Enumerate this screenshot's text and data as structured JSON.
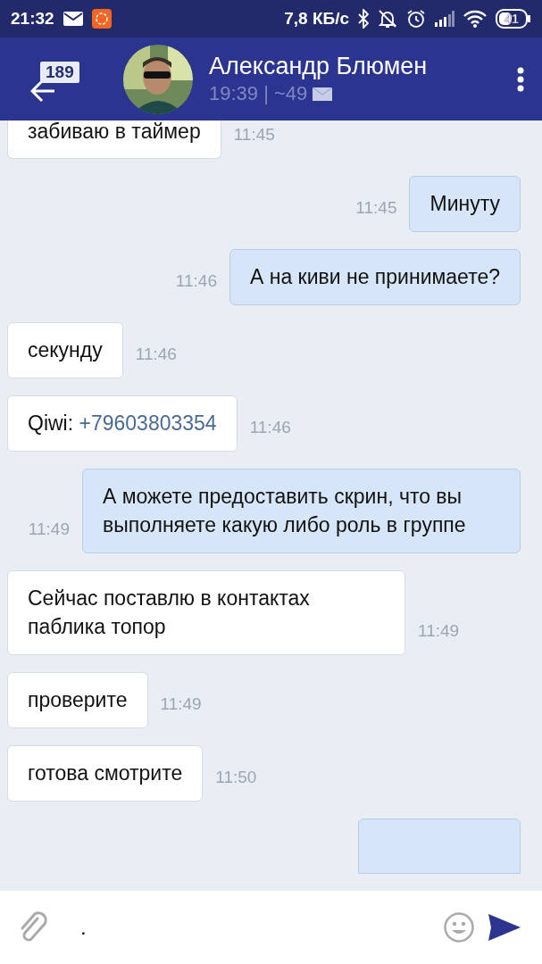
{
  "status_bar": {
    "time": "21:32",
    "speed": "7,8 КБ/с",
    "battery": "41"
  },
  "header": {
    "unread_badge": "189",
    "name": "Александр Блюмен",
    "last_seen": "19:39 | ~49"
  },
  "messages": [
    {
      "kind": "incoming",
      "text": "забиваю в таймер",
      "time": "11:45",
      "cut_top": true
    },
    {
      "kind": "outgoing",
      "text": "Минуту",
      "time": "11:45"
    },
    {
      "kind": "outgoing",
      "text": "А на киви не принимаете?",
      "time": "11:46"
    },
    {
      "kind": "incoming",
      "text": "секунду",
      "time": "11:46"
    },
    {
      "kind": "incoming",
      "text": "Qiwi: ",
      "link": "+79603803354",
      "time": "11:46"
    },
    {
      "kind": "outgoing",
      "text": "А можете предоставить скрин, что вы выполняете какую либо роль в группе",
      "time": "11:49"
    },
    {
      "kind": "incoming",
      "text": "Сейчас поставлю в контактах паблика топор",
      "time": "11:49"
    },
    {
      "kind": "incoming",
      "text": "проверите",
      "time": "11:49"
    },
    {
      "kind": "incoming",
      "text": "готова смотрите",
      "time": "11:50"
    },
    {
      "kind": "outgoing",
      "cut_bottom": true
    }
  ],
  "composer": {
    "value": "."
  }
}
